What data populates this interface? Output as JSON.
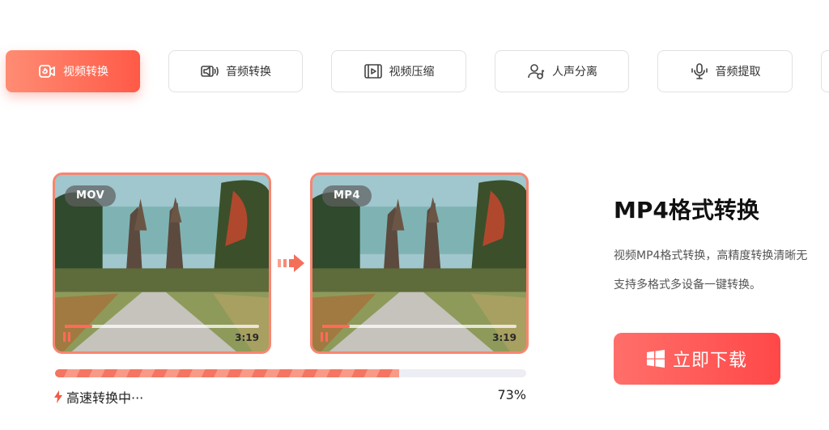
{
  "tabs": [
    {
      "label": "视频转换",
      "icon": "video-convert-icon",
      "active": true
    },
    {
      "label": "音频转换",
      "icon": "audio-speaker-icon",
      "active": false
    },
    {
      "label": "视频压缩",
      "icon": "video-compress-icon",
      "active": false
    },
    {
      "label": "人声分离",
      "icon": "voice-separation-icon",
      "active": false
    },
    {
      "label": "音频提取",
      "icon": "microphone-icon",
      "active": false
    }
  ],
  "preview": {
    "source": {
      "format": "MOV",
      "duration": "3:19"
    },
    "target": {
      "format": "MP4",
      "duration": "3:19"
    }
  },
  "conversion": {
    "status": "高速转换中···",
    "percent_label": "73%",
    "progress": 0.73
  },
  "info": {
    "title": "MP4格式转换",
    "desc_line1": "视频MP4格式转换，高精度转换清晰无",
    "desc_line2": "支持多格式多设备一键转换。"
  },
  "download_button": {
    "label": "立即下载",
    "icon": "windows-icon"
  },
  "colors": {
    "accent": "#ff5a47",
    "accent_light": "#ff8c73",
    "progress_stripe": "#f47561"
  }
}
